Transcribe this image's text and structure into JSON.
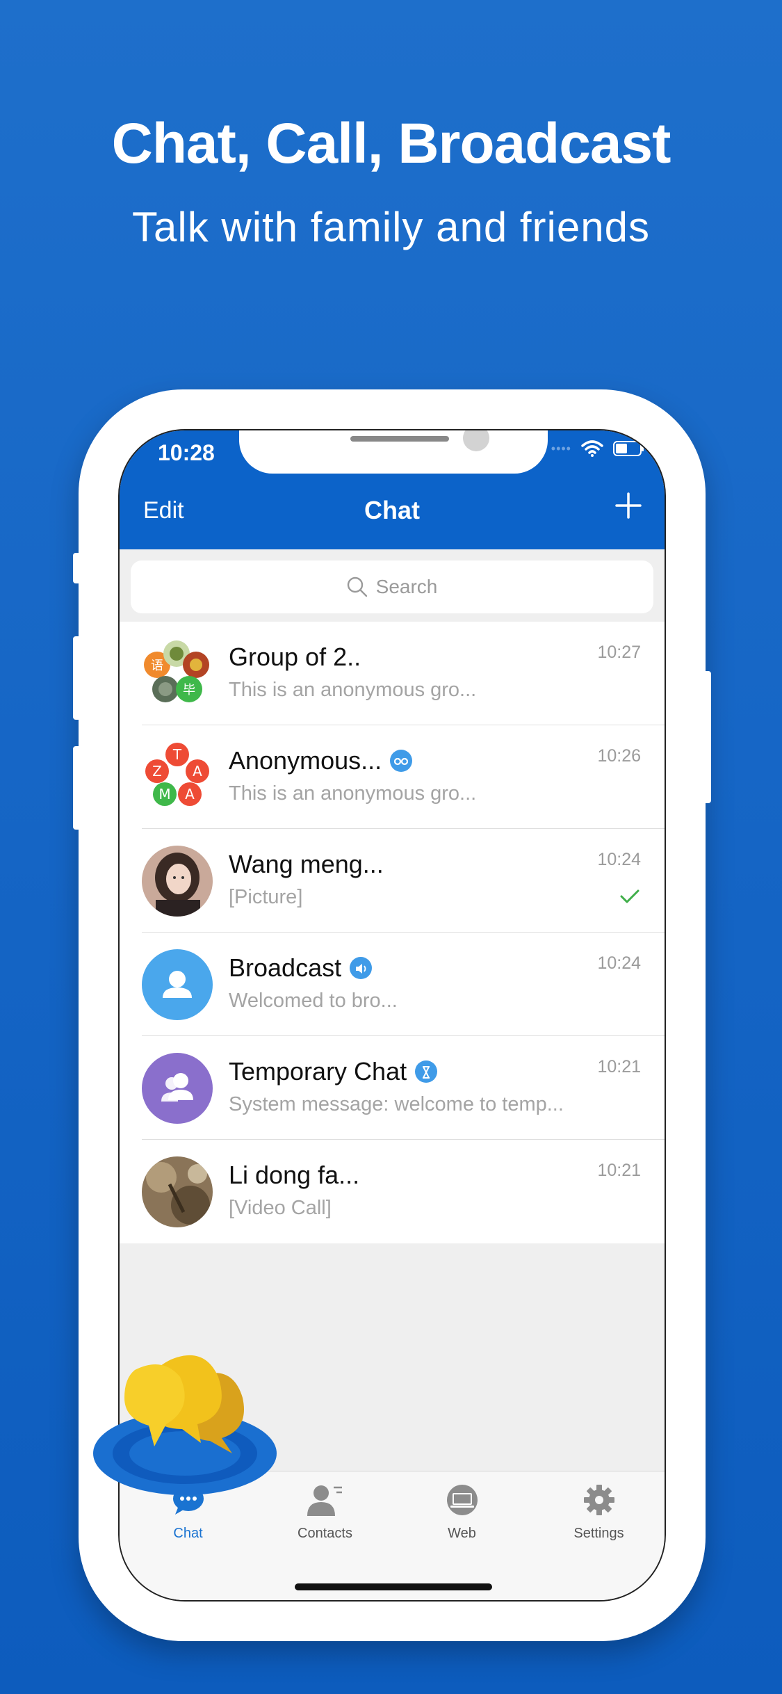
{
  "marketing": {
    "headline": "Chat, Call, Broadcast",
    "subheadline": "Talk with family and friends"
  },
  "status_bar": {
    "time": "10:28"
  },
  "nav": {
    "edit_label": "Edit",
    "title": "Chat",
    "add_icon": "plus-icon"
  },
  "search": {
    "placeholder": "Search"
  },
  "chats": [
    {
      "name": "Group of 2..",
      "preview": "This is an anonymous gro...",
      "time": "10:27",
      "avatar": "group-avatar",
      "avatar_letters": [
        "语",
        "毕"
      ]
    },
    {
      "name": "Anonymous...",
      "preview": "This is an anonymous gro...",
      "time": "10:26",
      "avatar": "letters-avatar",
      "avatar_letters": [
        "T",
        "Z",
        "A",
        "M",
        "A"
      ],
      "badge": "anonymous-icon"
    },
    {
      "name": "Wang meng...",
      "preview": "[Picture]",
      "time": "10:24",
      "avatar": "photo-avatar",
      "status": "read-check-icon"
    },
    {
      "name": "Broadcast",
      "preview": "Welcomed to bro...",
      "time": "10:24",
      "avatar": "person-avatar",
      "badge": "speaker-icon"
    },
    {
      "name": "Temporary Chat",
      "preview": "System message: welcome to temp...",
      "time": "10:21",
      "avatar": "people-avatar",
      "badge": "hourglass-icon"
    },
    {
      "name": "Li dong fa...",
      "preview": "[Video Call]",
      "time": "10:21",
      "avatar": "photo-avatar"
    }
  ],
  "tabs": [
    {
      "label": "Chat",
      "icon": "chat-bubble-icon",
      "active": true
    },
    {
      "label": "Contacts",
      "icon": "contacts-icon",
      "active": false
    },
    {
      "label": "Web",
      "icon": "web-icon",
      "active": false
    },
    {
      "label": "Settings",
      "icon": "gear-icon",
      "active": false
    }
  ],
  "colors": {
    "brand": "#0c63c9",
    "active_tab": "#1a73d1",
    "badge": "#3f9be8",
    "check": "#3fae49"
  }
}
